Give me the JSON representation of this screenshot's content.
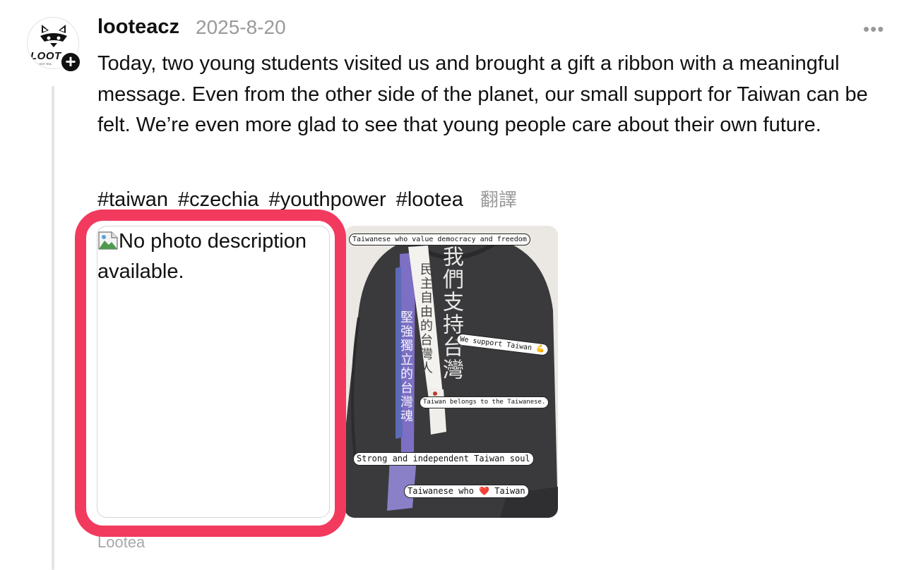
{
  "post": {
    "username": "looteacz",
    "date": "2025-8-20",
    "avatar": {
      "logo_text": "LOOT",
      "sub_text": "LOOT TEA",
      "badge_icon": "plus-icon"
    },
    "body": "Today, two young students visited us and brought a gift a ribbon with a meaningful message. Even from the other side of the planet, our small support for Taiwan can be felt. We’re even more glad to see that young people care about their own future.",
    "hashtags": [
      "#taiwan",
      "#czechia",
      "#youthpower",
      "#lootea"
    ],
    "translate_label": "翻譯",
    "more_icon": "ellipsis-icon",
    "images": {
      "broken_alt": "No photo description available.",
      "photo": {
        "captions": {
          "top": "Taiwanese who value democracy and freedom",
          "support": "We support Taiwan 💪",
          "belongs": "Taiwan belongs to the Taiwanese.",
          "soul": "Strong and independent Taiwan soul",
          "love": "Taiwanese who ❤️ Taiwan"
        },
        "vertical_text_main": "我們支持台灣",
        "vertical_text_white_ribbon": "民主自由的台灣人",
        "vertical_text_purple_ribbon": "堅強獨立的台灣魂"
      }
    },
    "author_footer": "Lootea",
    "colors": {
      "highlight": "#f23a5e",
      "muted": "#9a9a9a",
      "text": "#111111"
    }
  }
}
